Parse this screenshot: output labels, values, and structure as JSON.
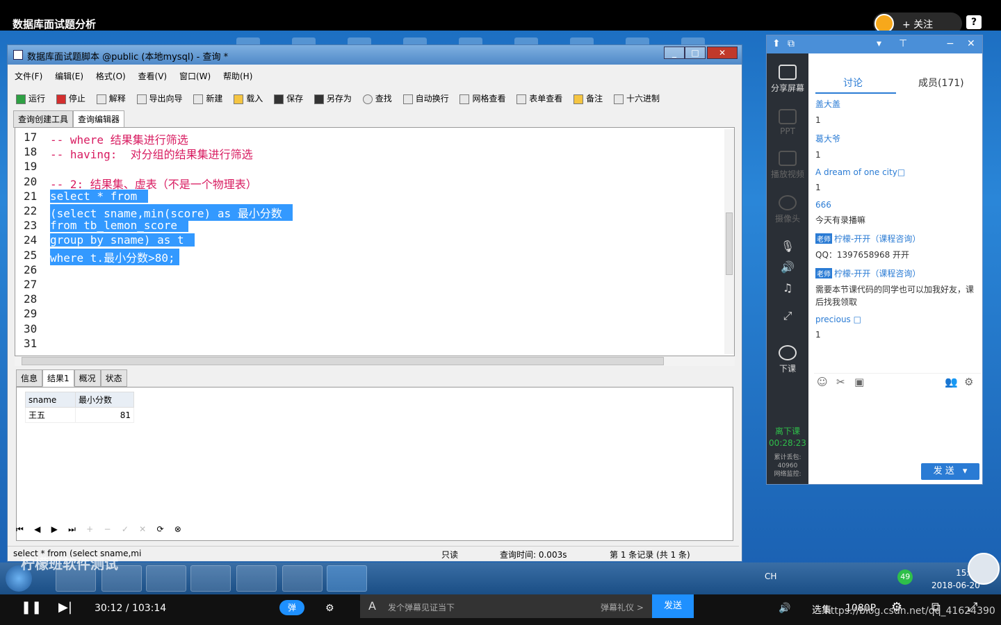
{
  "video": {
    "title": "数据库面试题分析",
    "follow": "+ 关注",
    "help": "?"
  },
  "navicat": {
    "window_title": "数据库面试题脚本 @public (本地mysql) - 查询 *",
    "menu": [
      "文件(F)",
      "编辑(E)",
      "格式(O)",
      "查看(V)",
      "窗口(W)",
      "帮助(H)"
    ],
    "toolbar": [
      "运行",
      "停止",
      "解释",
      "导出向导",
      "新建",
      "载入",
      "保存",
      "另存为",
      "查找",
      "自动换行",
      "网格查看",
      "表单查看",
      "备注",
      "十六进制"
    ],
    "tabs": [
      "查询创建工具",
      "查询编辑器"
    ],
    "lines": [
      {
        "n": "17",
        "text": "-- where 结果集进行筛选",
        "sel": false
      },
      {
        "n": "18",
        "text": "-- having:  对分组的结果集进行筛选",
        "sel": false
      },
      {
        "n": "19",
        "text": "",
        "sel": false
      },
      {
        "n": "20",
        "text": "-- 2: 结果集、虚表（不是一个物理表）",
        "sel": false
      },
      {
        "n": "21",
        "text": "select * from ",
        "sel": true
      },
      {
        "n": "22",
        "text": "(select sname,min(score) as 最小分数 ",
        "sel": true
      },
      {
        "n": "23",
        "text": "from tb_lemon_score ",
        "sel": true
      },
      {
        "n": "24",
        "text": "group by sname) as t ",
        "sel": true
      },
      {
        "n": "25",
        "text": "where t.最小分数>80;",
        "sel": true
      },
      {
        "n": "26",
        "text": "",
        "sel": false
      },
      {
        "n": "27",
        "text": "",
        "sel": false
      },
      {
        "n": "28",
        "text": "",
        "sel": false
      },
      {
        "n": "29",
        "text": "",
        "sel": false
      },
      {
        "n": "30",
        "text": "",
        "sel": false
      },
      {
        "n": "31",
        "text": "",
        "sel": false
      }
    ],
    "result_tabs": [
      "信息",
      "结果1",
      "概况",
      "状态"
    ],
    "result": {
      "columns": [
        "sname",
        "最小分数"
      ],
      "rows": [
        [
          "王五",
          "81"
        ]
      ]
    },
    "status": {
      "sql": "select * from  (select sname,mi",
      "readonly": "只读",
      "time": "查询时间: 0.003s",
      "records": "第 1 条记录 (共 1 条)"
    }
  },
  "chat": {
    "tab_discuss": "讨论",
    "tab_members": "成员(171)",
    "sidebar": [
      {
        "label": "分享屏幕",
        "dim": false
      },
      {
        "label": "PPT",
        "dim": true
      },
      {
        "label": "播放视频",
        "dim": true
      },
      {
        "label": "摄像头",
        "dim": true
      },
      {
        "label": "下课",
        "dim": false
      }
    ],
    "messages": [
      {
        "name": "盖大盖",
        "teacher": false,
        "content": "1"
      },
      {
        "name": "葛大爷",
        "teacher": false,
        "content": "1"
      },
      {
        "name": "A dream of one city□",
        "teacher": false,
        "content": "1"
      },
      {
        "name": "666",
        "teacher": false,
        "content": "今天有录播嘛"
      },
      {
        "name": "柠檬-开开（课程咨询）",
        "teacher": true,
        "content": "QQ：1397658968  开开"
      },
      {
        "name": "柠檬-开开（课程咨询）",
        "teacher": true,
        "content": "需要本节课代码的同学也可以加我好友，课后找我领取"
      },
      {
        "name": "precious □",
        "teacher": false,
        "content": "1"
      }
    ],
    "teacher_tag": "老师",
    "send": "发 送",
    "timer_label": "离下课",
    "timer": "00:28:23",
    "stat1": "累计丢包:",
    "stat2": "40960",
    "stat3": "网络监控:"
  },
  "taskbar": {
    "ime": "CH",
    "time": "15:31",
    "date": "2018-06-20",
    "badge": "49"
  },
  "watermark": "柠檬班软件测试",
  "player": {
    "time": "30:12 / 103:14",
    "danmu": "弹",
    "placeholder": "发个弹幕见证当下",
    "gift": "弹幕礼仪 >",
    "send": "发送",
    "quality_sel": "选集",
    "quality": "1080P",
    "url": "https://blog.csdn.net/qq_41624390"
  }
}
